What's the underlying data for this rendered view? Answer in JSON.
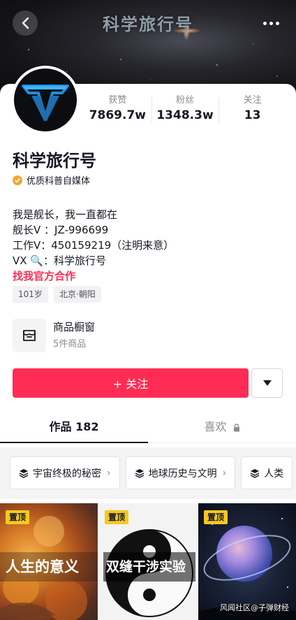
{
  "header": {
    "banner_title": "科学旅行号",
    "back_icon": "chevron-left-icon",
    "more_icon": "more-dots-icon"
  },
  "profile": {
    "stats": [
      {
        "label": "获赞",
        "value": "7869.7w"
      },
      {
        "label": "粉丝",
        "value": "1348.3w"
      },
      {
        "label": "关注",
        "value": "13"
      }
    ],
    "name": "科学旅行号",
    "verification": "优质科普自媒体",
    "bio_lines": [
      "我是舰长，我一直都在",
      "舰长V ：JZ-996699",
      "工作V：450159219（注明来意）",
      "VX 🔍：科学旅行号"
    ],
    "cooperation_link": "找我官方合作",
    "tags": [
      "101岁",
      "北京·朝阳"
    ]
  },
  "shop": {
    "title": "商品橱窗",
    "subtitle": "5件商品"
  },
  "actions": {
    "follow_label": "+ 关注"
  },
  "tabs": [
    {
      "label": "作品 182",
      "active": true
    },
    {
      "label": "喜欢",
      "active": false,
      "locked": true
    }
  ],
  "collections": [
    {
      "label": "宇宙终极的秘密"
    },
    {
      "label": "地球历史与文明"
    },
    {
      "label": "人类"
    }
  ],
  "videos": [
    {
      "pinned": "置顶",
      "caption": "人生的意义"
    },
    {
      "pinned": "置顶",
      "caption": "双缝干涉实验"
    },
    {
      "pinned": "置顶",
      "caption": ""
    }
  ],
  "watermark": "风闻社区@子弹财经",
  "colors": {
    "accent": "#fe2c55",
    "pin": "#f8c81e",
    "verify_badge": "#f0a735"
  }
}
